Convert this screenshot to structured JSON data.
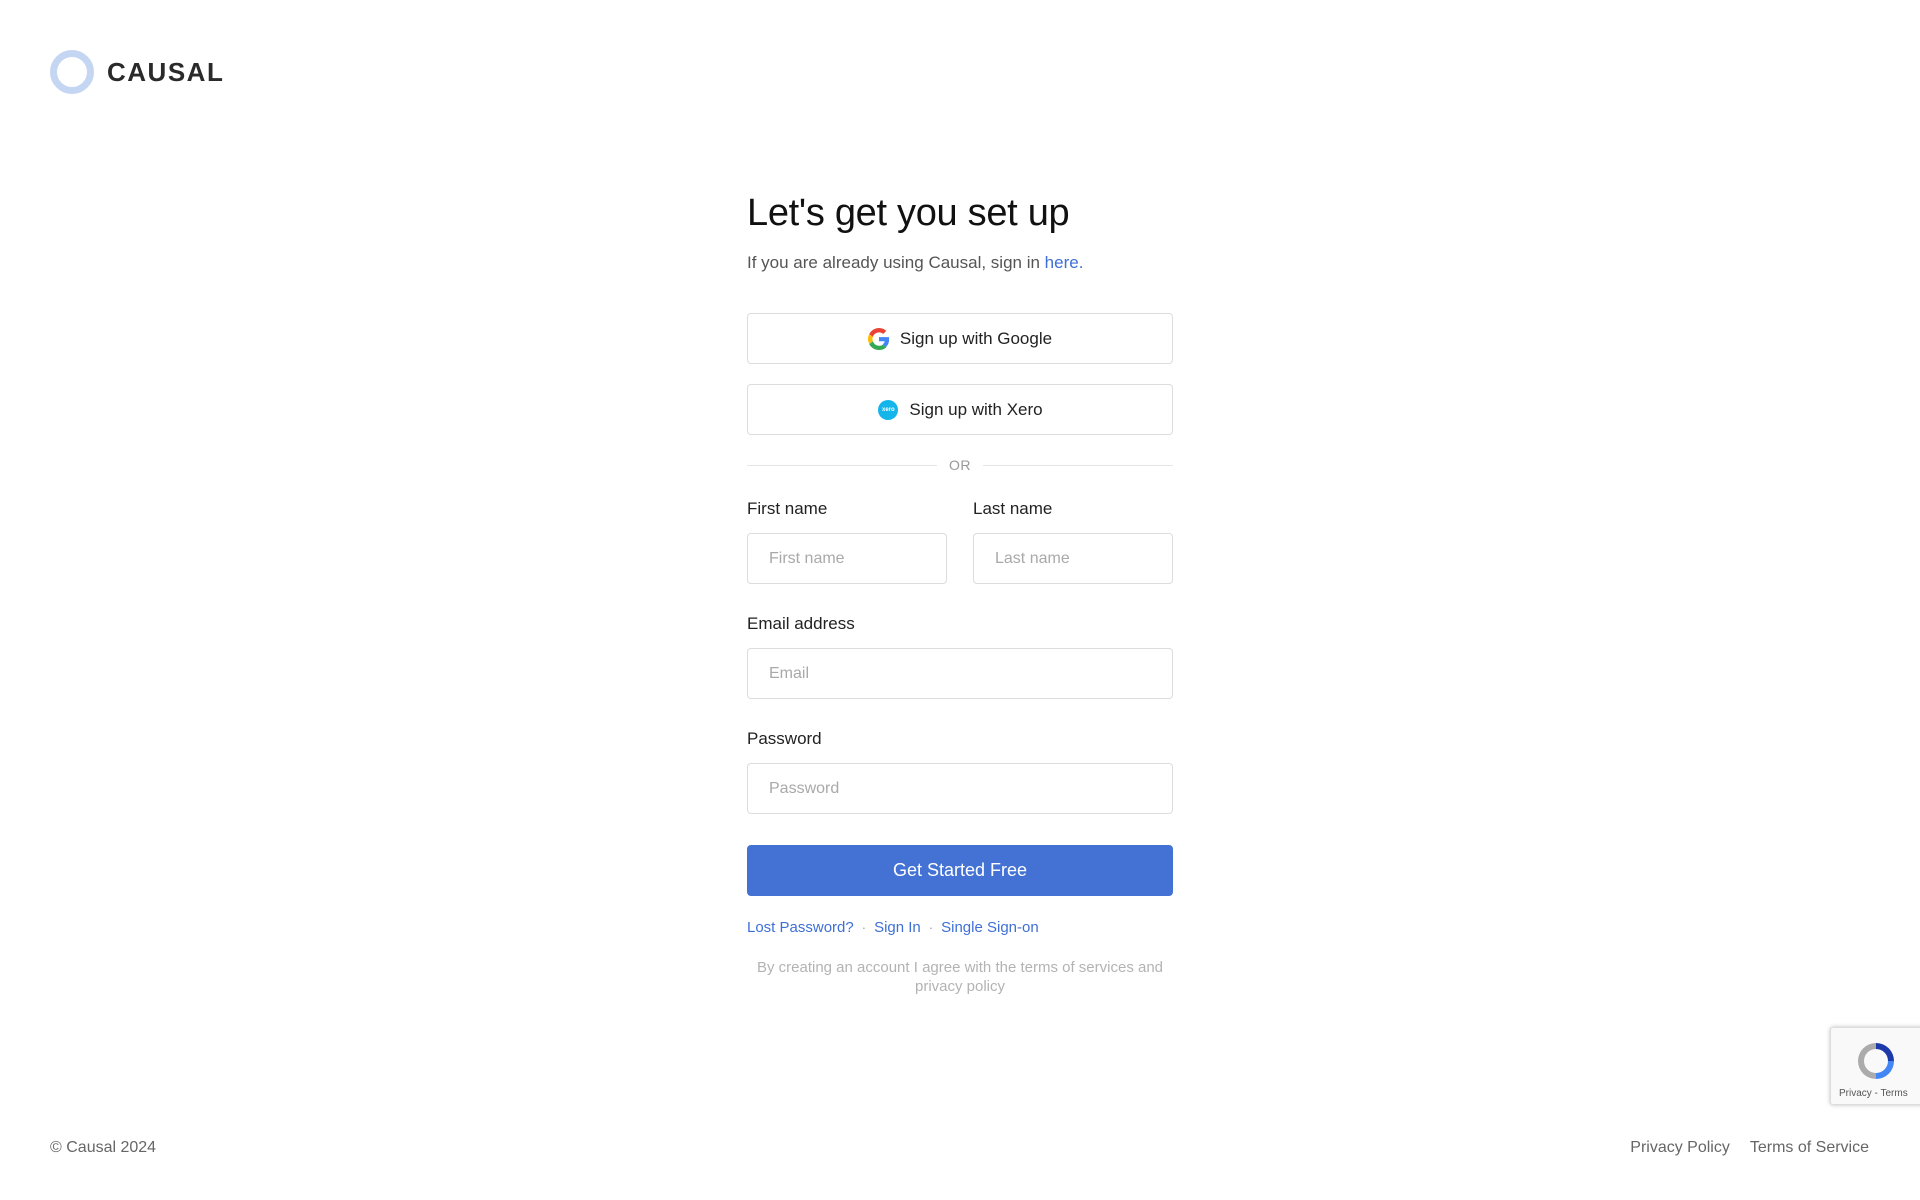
{
  "brand": {
    "name": "CAUSAL",
    "logo_icon": "ring-logo-icon"
  },
  "heading": {
    "title": "Let's get you set up",
    "subtitle_prefix": "If you are already using Causal, sign in ",
    "subtitle_link": "here."
  },
  "oauth": {
    "google_label": "Sign up with Google",
    "google_icon": "google-icon",
    "xero_label": "Sign up with Xero",
    "xero_icon": "xero-icon",
    "xero_icon_text": "xero"
  },
  "divider": {
    "label": "OR"
  },
  "fields": {
    "first_name": {
      "label": "First name",
      "placeholder": "First name"
    },
    "last_name": {
      "label": "Last name",
      "placeholder": "Last name"
    },
    "email": {
      "label": "Email address",
      "placeholder": "Email"
    },
    "password": {
      "label": "Password",
      "placeholder": "Password"
    }
  },
  "submit": {
    "label": "Get Started Free",
    "color": "#4472d4"
  },
  "links": {
    "lost_password": "Lost Password?",
    "separator": "·",
    "sign_in": "Sign In",
    "sso": "Single Sign-on"
  },
  "terms": "By creating an account I agree with the terms of services and privacy policy",
  "footer": {
    "copyright": "© Causal 2024",
    "privacy": "Privacy Policy",
    "terms": "Terms of Service"
  },
  "recaptcha": {
    "label": "Privacy - Terms",
    "icon": "recaptcha-icon"
  },
  "colors": {
    "link": "#3f6fd6",
    "logo_ring": "#c5d6f3"
  }
}
